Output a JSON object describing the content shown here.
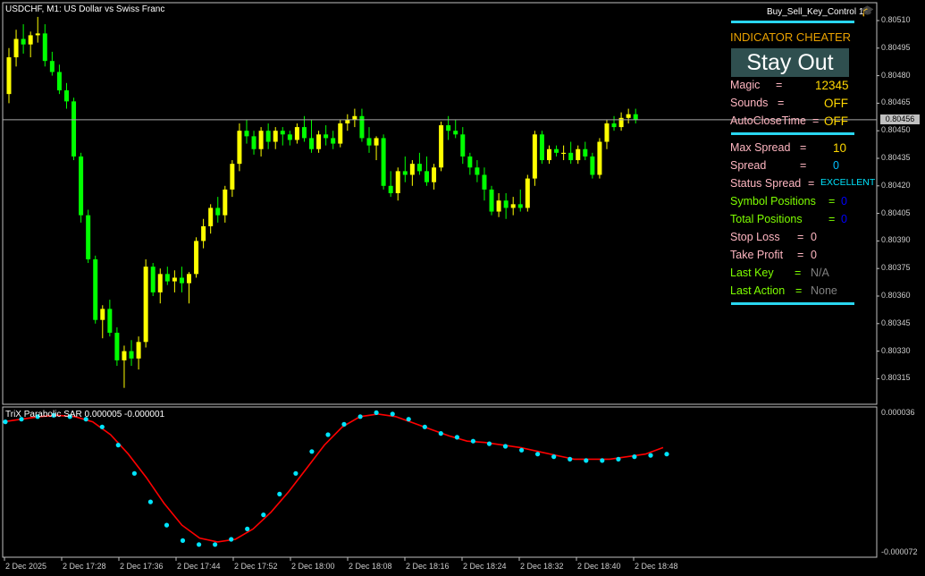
{
  "chart": {
    "title": "USDCHF, M1:  US Dollar vs Swiss Franc",
    "ea_name": "Buy_Sell_Key_Control 1",
    "current_price": "0.80456",
    "price_levels": [
      "0.80510",
      "0.80495",
      "0.80480",
      "0.80465",
      "0.80450",
      "0.80435",
      "0.80420",
      "0.80405",
      "0.80390",
      "0.80375",
      "0.80360",
      "0.80345",
      "0.80330",
      "0.80315"
    ],
    "time_labels": [
      "2 Dec 2025",
      "2 Dec 17:28",
      "2 Dec 17:36",
      "2 Dec 17:44",
      "2 Dec 17:52",
      "2 Dec 18:00",
      "2 Dec 18:08",
      "2 Dec 18:16",
      "2 Dec 18:24",
      "2 Dec 18:32",
      "2 Dec 18:40",
      "2 Dec 18:48"
    ],
    "colors": {
      "bull": "#ffff00",
      "bear": "#00ff00",
      "grid_line": "#c0c0c0",
      "trix": "#ff0000",
      "sar": "#00e5ff"
    },
    "candles_ohlc": [
      [
        0.8047,
        0.80495,
        0.80465,
        0.8049
      ],
      [
        0.8049,
        0.80505,
        0.80485,
        0.805
      ],
      [
        0.805,
        0.80508,
        0.80492,
        0.80497
      ],
      [
        0.80497,
        0.80504,
        0.8049,
        0.80502
      ],
      [
        0.80502,
        0.80512,
        0.80498,
        0.80503
      ],
      [
        0.80503,
        0.80508,
        0.80485,
        0.80488
      ],
      [
        0.80488,
        0.80493,
        0.8048,
        0.80482
      ],
      [
        0.80482,
        0.80486,
        0.8047,
        0.80472
      ],
      [
        0.80472,
        0.80476,
        0.80462,
        0.80466
      ],
      [
        0.80466,
        0.80468,
        0.80434,
        0.80436
      ],
      [
        0.80436,
        0.80438,
        0.804,
        0.80404
      ],
      [
        0.80404,
        0.80407,
        0.80378,
        0.8038
      ],
      [
        0.8038,
        0.80382,
        0.80345,
        0.80347
      ],
      [
        0.80347,
        0.80355,
        0.80337,
        0.80353
      ],
      [
        0.80353,
        0.80358,
        0.80338,
        0.8034
      ],
      [
        0.8034,
        0.80343,
        0.80322,
        0.80325
      ],
      [
        0.80325,
        0.80333,
        0.8031,
        0.8033
      ],
      [
        0.8033,
        0.80336,
        0.80322,
        0.80326
      ],
      [
        0.80326,
        0.80338,
        0.8032,
        0.80335
      ],
      [
        0.80335,
        0.8038,
        0.80332,
        0.80376
      ],
      [
        0.80376,
        0.80378,
        0.8036,
        0.80362
      ],
      [
        0.80362,
        0.80375,
        0.80356,
        0.80372
      ],
      [
        0.80372,
        0.80376,
        0.80366,
        0.80368
      ],
      [
        0.80368,
        0.80374,
        0.80362,
        0.8037
      ],
      [
        0.8037,
        0.80376,
        0.80362,
        0.80367
      ],
      [
        0.80367,
        0.80373,
        0.80356,
        0.80372
      ],
      [
        0.80372,
        0.80392,
        0.8037,
        0.8039
      ],
      [
        0.8039,
        0.80402,
        0.80386,
        0.80398
      ],
      [
        0.80398,
        0.8041,
        0.80394,
        0.80408
      ],
      [
        0.80408,
        0.80414,
        0.804,
        0.80404
      ],
      [
        0.80404,
        0.8042,
        0.804,
        0.80418
      ],
      [
        0.80418,
        0.80434,
        0.80414,
        0.80432
      ],
      [
        0.80432,
        0.80454,
        0.80428,
        0.8045
      ],
      [
        0.8045,
        0.80456,
        0.80443,
        0.80447
      ],
      [
        0.80447,
        0.8045,
        0.80437,
        0.8044
      ],
      [
        0.8044,
        0.80452,
        0.80436,
        0.8045
      ],
      [
        0.8045,
        0.80454,
        0.8044,
        0.80444
      ],
      [
        0.80444,
        0.80452,
        0.8044,
        0.8045
      ],
      [
        0.8045,
        0.80452,
        0.80442,
        0.80448
      ],
      [
        0.80448,
        0.8045,
        0.80442,
        0.80445
      ],
      [
        0.80445,
        0.80454,
        0.80443,
        0.80452
      ],
      [
        0.80452,
        0.80458,
        0.80444,
        0.80446
      ],
      [
        0.80446,
        0.80456,
        0.80438,
        0.8044
      ],
      [
        0.8044,
        0.8045,
        0.80438,
        0.80448
      ],
      [
        0.80448,
        0.80453,
        0.80442,
        0.80446
      ],
      [
        0.80446,
        0.8045,
        0.8044,
        0.80443
      ],
      [
        0.80443,
        0.80456,
        0.80441,
        0.80454
      ],
      [
        0.80454,
        0.80459,
        0.8045,
        0.80456
      ],
      [
        0.80456,
        0.80462,
        0.80452,
        0.80458
      ],
      [
        0.80458,
        0.80462,
        0.80444,
        0.80446
      ],
      [
        0.80446,
        0.80452,
        0.80438,
        0.80442
      ],
      [
        0.80442,
        0.80447,
        0.80434,
        0.80446
      ],
      [
        0.80446,
        0.80448,
        0.80418,
        0.8042
      ],
      [
        0.8042,
        0.80428,
        0.80414,
        0.80416
      ],
      [
        0.80416,
        0.8043,
        0.80412,
        0.80428
      ],
      [
        0.80428,
        0.80436,
        0.80422,
        0.80426
      ],
      [
        0.80426,
        0.80434,
        0.8042,
        0.80432
      ],
      [
        0.80432,
        0.80438,
        0.80426,
        0.80428
      ],
      [
        0.80428,
        0.80436,
        0.8042,
        0.80422
      ],
      [
        0.80422,
        0.80432,
        0.80418,
        0.8043
      ],
      [
        0.8043,
        0.80455,
        0.80428,
        0.80453
      ],
      [
        0.80453,
        0.80458,
        0.80445,
        0.8045
      ],
      [
        0.8045,
        0.80456,
        0.80446,
        0.80448
      ],
      [
        0.80448,
        0.80452,
        0.80432,
        0.80436
      ],
      [
        0.80436,
        0.80438,
        0.80426,
        0.8043
      ],
      [
        0.8043,
        0.80434,
        0.80422,
        0.80426
      ],
      [
        0.80426,
        0.8043,
        0.80412,
        0.80418
      ],
      [
        0.80418,
        0.8042,
        0.80404,
        0.80406
      ],
      [
        0.80406,
        0.80416,
        0.80403,
        0.80412
      ],
      [
        0.80412,
        0.80416,
        0.80402,
        0.80408
      ],
      [
        0.80408,
        0.80414,
        0.80404,
        0.8041
      ],
      [
        0.8041,
        0.80418,
        0.80406,
        0.80408
      ],
      [
        0.80408,
        0.80426,
        0.80406,
        0.80424
      ],
      [
        0.80424,
        0.8045,
        0.8042,
        0.80448
      ],
      [
        0.80448,
        0.8045,
        0.80432,
        0.80434
      ],
      [
        0.80434,
        0.80442,
        0.80432,
        0.8044
      ],
      [
        0.8044,
        0.80442,
        0.80436,
        0.80438
      ],
      [
        0.80438,
        0.80442,
        0.80434,
        0.80438
      ],
      [
        0.80438,
        0.80444,
        0.80432,
        0.80434
      ],
      [
        0.80434,
        0.80442,
        0.80432,
        0.8044
      ],
      [
        0.8044,
        0.80444,
        0.80434,
        0.80436
      ],
      [
        0.80436,
        0.80438,
        0.80424,
        0.80426
      ],
      [
        0.80426,
        0.80446,
        0.80424,
        0.80444
      ],
      [
        0.80444,
        0.80456,
        0.8044,
        0.80454
      ],
      [
        0.80454,
        0.80458,
        0.8045,
        0.80452
      ],
      [
        0.80452,
        0.8046,
        0.8045,
        0.80457
      ],
      [
        0.80457,
        0.80462,
        0.80454,
        0.80459
      ],
      [
        0.80459,
        0.80462,
        0.80454,
        0.80456
      ]
    ]
  },
  "indicator": {
    "title": "TriX Parabolic SAR 0.000005 -0.000001",
    "top_label": "0.000036",
    "bottom_label": "-0.000072",
    "trix_values": [
      2.8e-05,
      3e-05,
      3.2e-05,
      3.3e-05,
      3.2e-05,
      2.8e-05,
      1.8e-05,
      3e-06,
      -1.5e-05,
      -3.5e-05,
      -5.2e-05,
      -6.2e-05,
      -6.5e-05,
      -6.3e-05,
      -5.5e-05,
      -4.2e-05,
      -2.6e-05,
      -8e-06,
      1e-05,
      2.4e-05,
      3.2e-05,
      3.4e-05,
      3.2e-05,
      2.7e-05,
      2.2e-05,
      1.7e-05,
      1.3e-05,
      1.2e-05,
      1e-05,
      8e-06,
      5e-06,
      2e-06,
      -1e-06,
      -1e-06,
      -1e-06,
      1e-06,
      3e-06,
      8e-06
    ],
    "sar_values": [
      2.8e-05,
      3e-05,
      3.2e-05,
      3.3e-05,
      3.2e-05,
      3e-05,
      2.4e-05,
      1e-05,
      -1.2e-05,
      -3.4e-05,
      -5.2e-05,
      -6.4e-05,
      -6.7e-05,
      -6.7e-05,
      -6.3e-05,
      -5.5e-05,
      -4.4e-05,
      -2.8e-05,
      -1.2e-05,
      5e-06,
      1.8e-05,
      2.6e-05,
      3.2e-05,
      3.5e-05,
      3.4e-05,
      3e-05,
      2.4e-05,
      1.9e-05,
      1.6e-05,
      1.3e-05,
      1.1e-05,
      9e-06,
      6e-06,
      3e-06,
      1e-06,
      -1e-06,
      -2e-06,
      -2e-06,
      -1e-06,
      1e-06,
      2e-06,
      3e-06
    ]
  },
  "panel": {
    "title": "INDICATOR CHEATER",
    "button_label": "Stay Out",
    "rows": [
      {
        "label": "Magic",
        "eq": "=",
        "value": "12345",
        "label_color": "#ffb6c1",
        "value_color": "#ffd700"
      },
      {
        "label": "Sounds",
        "eq": "=",
        "value": "OFF",
        "label_color": "#ffb6c1",
        "value_color": "#ffd700"
      },
      {
        "label": "AutoCloseTime",
        "eq": "=",
        "value": "OFF",
        "label_color": "#ffb6c1",
        "value_color": "#ffd700"
      },
      {
        "label": "Max Spread",
        "eq": "=",
        "value": "10",
        "label_color": "#ffb6c1",
        "value_color": "#ffd700"
      },
      {
        "label": "Spread",
        "eq": "=",
        "value": "0",
        "label_color": "#ffb6c1",
        "value_color": "#00bfff"
      },
      {
        "label": "Status Spread",
        "eq": "=",
        "value": "EXCELLENT",
        "label_color": "#ffb6c1",
        "value_color": "#00e5ff"
      },
      {
        "label": "Symbol Positions",
        "eq": "=",
        "value": "0",
        "label_color": "#7fff00",
        "value_color": "#0000ff"
      },
      {
        "label": "Total Positions",
        "eq": "=",
        "value": "0",
        "label_color": "#7fff00",
        "value_color": "#0000ff"
      },
      {
        "label": "Stop Loss",
        "eq": "=",
        "value": "0",
        "label_color": "#ffb6c1",
        "value_color": "#ffb6c1"
      },
      {
        "label": "Take Profit",
        "eq": "=",
        "value": "0",
        "label_color": "#ffb6c1",
        "value_color": "#ffb6c1"
      },
      {
        "label": "Last Key",
        "eq": "=",
        "value": "N/A",
        "label_color": "#7fff00",
        "value_color": "#808080"
      },
      {
        "label": "Last Action",
        "eq": "=",
        "value": "None",
        "label_color": "#7fff00",
        "value_color": "#808080"
      }
    ]
  }
}
